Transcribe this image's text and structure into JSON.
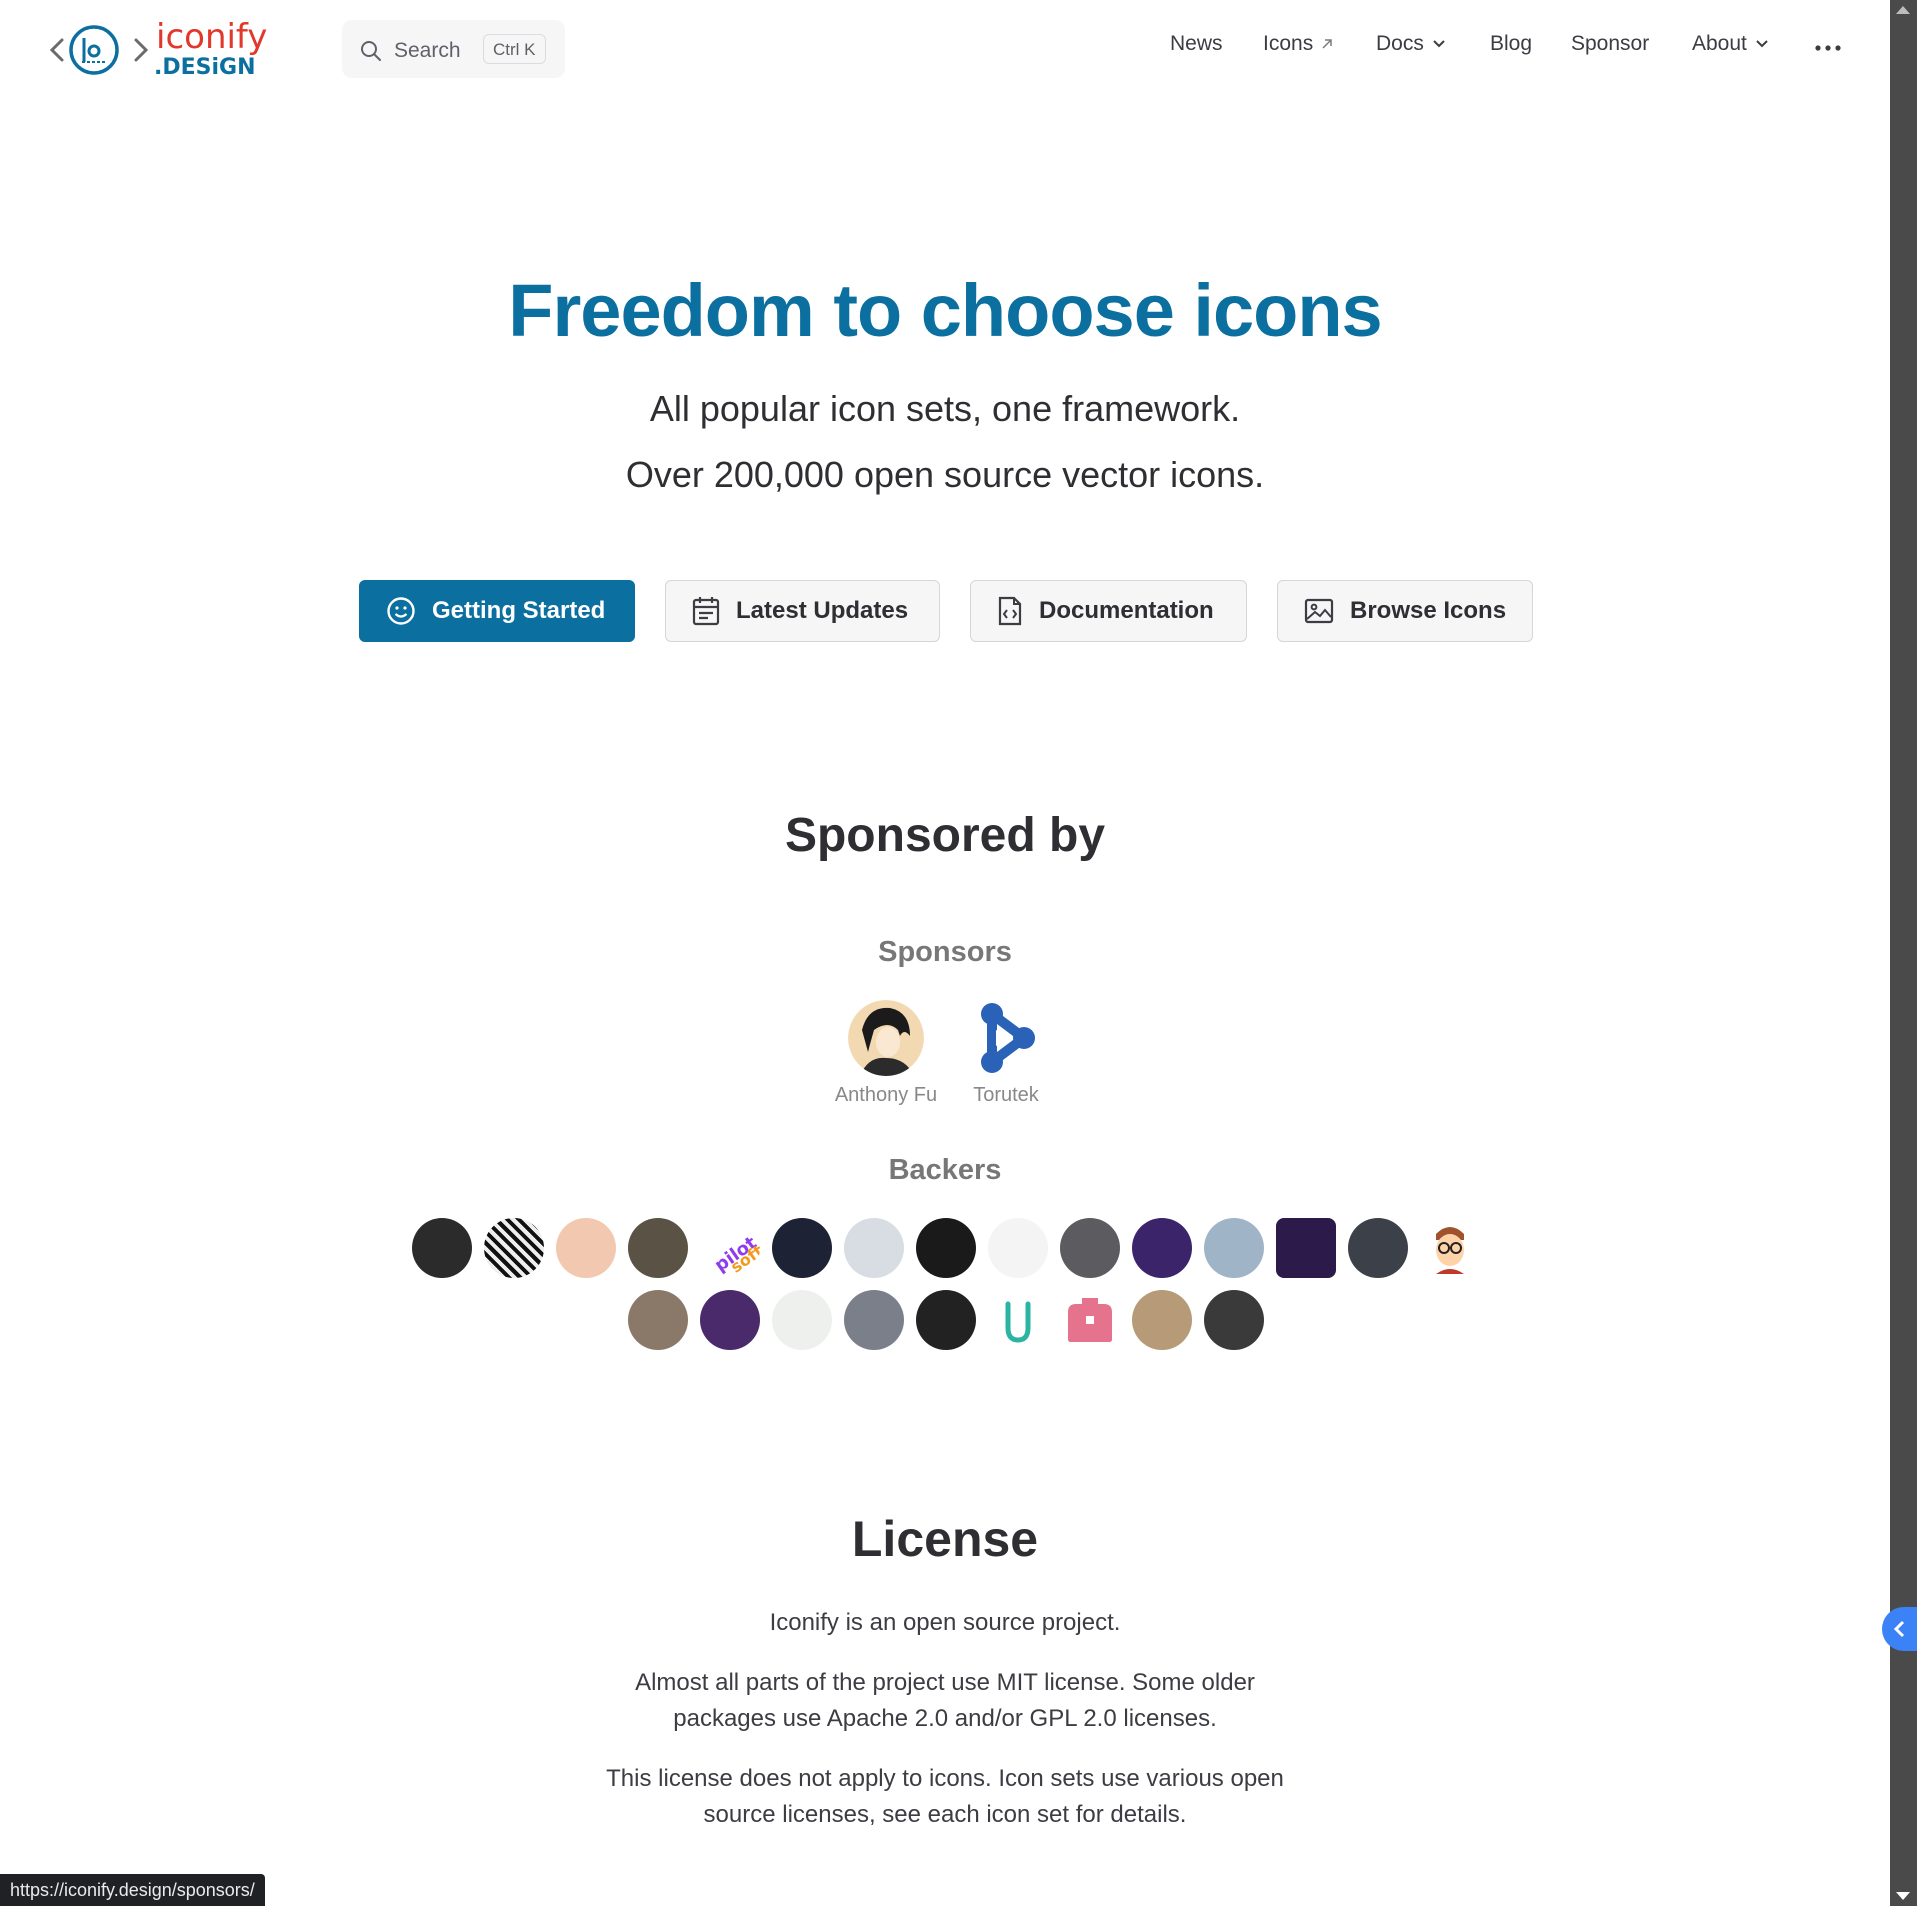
{
  "header": {
    "logo": {
      "word_top": "iconify",
      "word_bottom": ".DESiGN"
    },
    "search": {
      "label": "Search",
      "shortcut": "Ctrl K"
    },
    "nav": [
      {
        "label": "News"
      },
      {
        "label": "Icons",
        "icon": "external-arrow-icon"
      },
      {
        "label": "Docs",
        "icon": "chevron-down-icon"
      },
      {
        "label": "Blog"
      },
      {
        "label": "Sponsor"
      },
      {
        "label": "About",
        "icon": "chevron-down-icon"
      }
    ],
    "more_icon": "more-dots-icon"
  },
  "hero": {
    "title": "Freedom to choose icons",
    "tagline_1": "All popular icon sets, one framework.",
    "tagline_2": "Over 200,000 open source vector icons."
  },
  "actions": [
    {
      "label": "Getting Started",
      "icon": "smiley-icon",
      "primary": true
    },
    {
      "label": "Latest Updates",
      "icon": "calendar-icon",
      "primary": false
    },
    {
      "label": "Documentation",
      "icon": "code-file-icon",
      "primary": false
    },
    {
      "label": "Browse Icons",
      "icon": "image-icon",
      "primary": false
    }
  ],
  "sponsored": {
    "title": "Sponsored by",
    "sponsors_label": "Sponsors",
    "sponsors": [
      {
        "name": "Anthony Fu"
      },
      {
        "name": "Torutek"
      }
    ],
    "backers_label": "Backers",
    "backer_count": 24
  },
  "license": {
    "title": "License",
    "p1": "Iconify is an open source project.",
    "p2_line1": "Almost all parts of the project use MIT license. Some older",
    "p2_line2": "packages use Apache 2.0 and/or GPL 2.0 licenses.",
    "p3_line1": "This license does not apply to icons. Icon sets use various open",
    "p3_line2": "source licenses, see each icon set for details."
  },
  "status_url": "https://iconify.design/sponsors/",
  "colors": {
    "brand": "#0b6f9f",
    "logo_red": "#e2372b",
    "text": "#3c3c43"
  }
}
